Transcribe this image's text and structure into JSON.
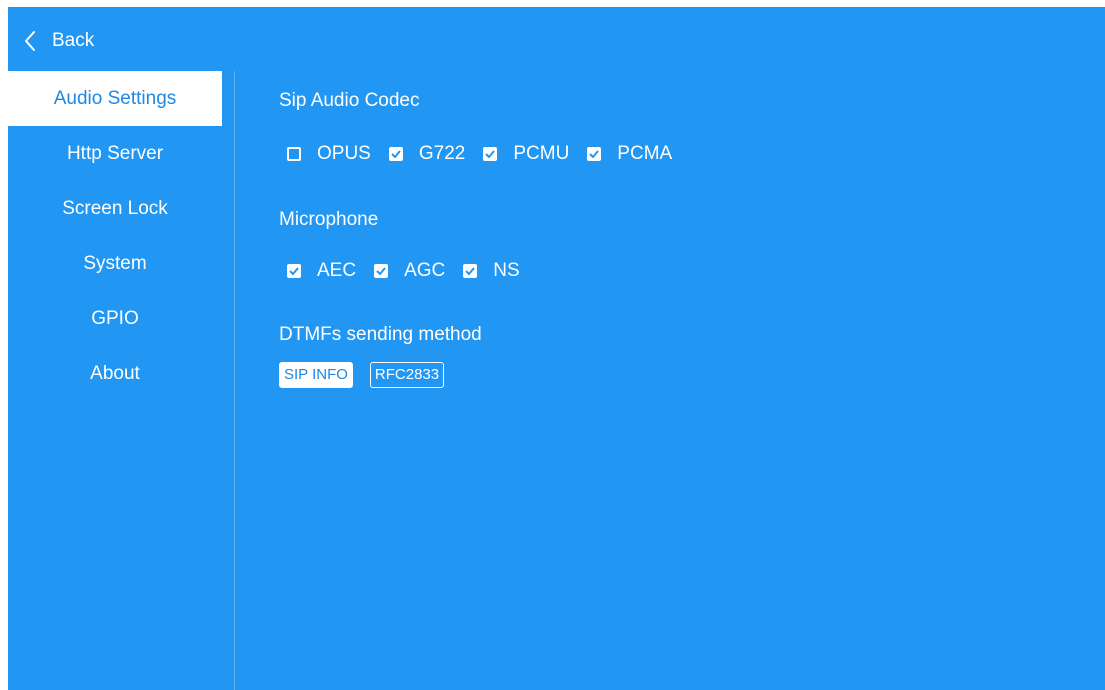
{
  "colors": {
    "background": "#2196f3",
    "active_item_bg": "#ffffff",
    "active_item_text": "#1e88e5",
    "text": "#ffffff"
  },
  "topbar": {
    "back_icon": "chevron-left-icon",
    "back_label": "Back"
  },
  "sidebar": {
    "items": [
      {
        "label": "Audio Settings",
        "active": true
      },
      {
        "label": "Http Server",
        "active": false
      },
      {
        "label": "Screen Lock",
        "active": false
      },
      {
        "label": "System",
        "active": false
      },
      {
        "label": "GPIO",
        "active": false
      },
      {
        "label": "About",
        "active": false
      }
    ]
  },
  "codec": {
    "title": "Sip Audio Codec",
    "options": [
      {
        "label": "OPUS",
        "checked": false
      },
      {
        "label": "G722",
        "checked": true
      },
      {
        "label": "PCMU",
        "checked": true
      },
      {
        "label": "PCMA",
        "checked": true
      }
    ]
  },
  "microphone": {
    "title": "Microphone",
    "options": [
      {
        "label": "AEC",
        "checked": true
      },
      {
        "label": "AGC",
        "checked": true
      },
      {
        "label": "NS",
        "checked": true
      }
    ]
  },
  "dtmf": {
    "title": "DTMFs sending method",
    "options": [
      {
        "label": "SIP INFO",
        "selected": true
      },
      {
        "label": "RFC2833",
        "selected": false
      }
    ]
  }
}
